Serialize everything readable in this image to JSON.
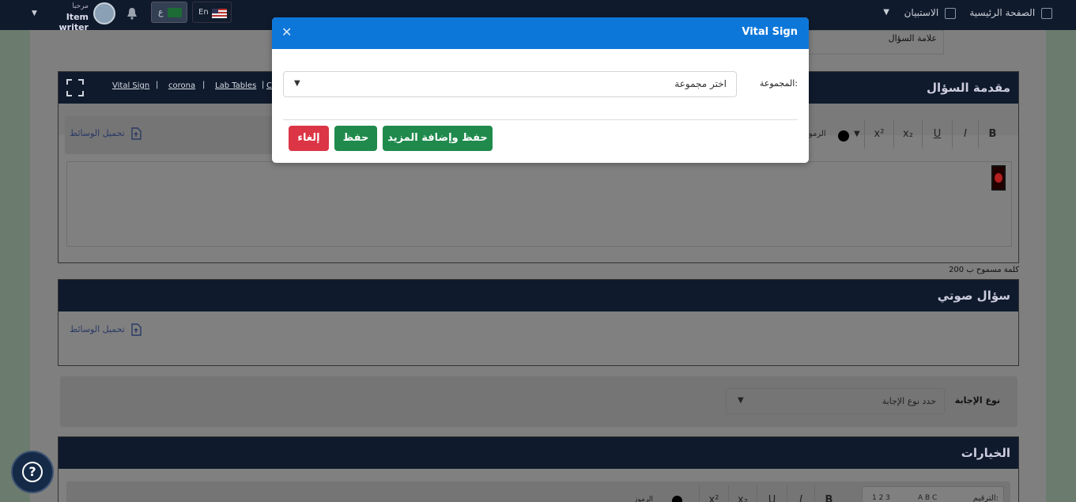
{
  "topbar": {
    "home": "الصفحة الرئيسية",
    "questionnaires": "الاستبيان",
    "greeting": "مرحبا",
    "user_name": "Item writer",
    "lang_ar": "ع",
    "lang_en": "En"
  },
  "question_mark": {
    "label": "علامة السؤال"
  },
  "intro_section": {
    "title": "مقدمة السؤال",
    "crumbs": [
      "Vital Sign",
      "corona",
      "Lab Tables",
      "C"
    ],
    "symbols_label": "الرموز",
    "upload_label": "تحميل الوسائط",
    "word_limit": "200 كلمة مسموح ب"
  },
  "toolbar": {
    "bold": "B",
    "italic": "I",
    "underline": "U",
    "sub": "x₂",
    "sup": "x²"
  },
  "audio_section": {
    "title": "سؤال صوتي",
    "upload_label": "تحميل الوسائط"
  },
  "answer_type": {
    "label": "نوع الإجابة",
    "placeholder": "حدد نوع الإجابة"
  },
  "options_section": {
    "title": "الخيارات",
    "numbering_label": "الترقيم:",
    "numbering_abc": "A B C",
    "numbering_123": "1 2 3",
    "symbols_label": "الرموز"
  },
  "modal": {
    "title": "Vital Sign",
    "field_label": "المجموعة:",
    "select_value": "اختر مجموعة",
    "btn_save_more": "حفظ وإضافة المزيد",
    "btn_save": "حفظ",
    "btn_cancel": "إلغاء"
  },
  "colors": {
    "modal_header": "#0d77d9",
    "save": "#1f8a4c",
    "cancel": "#dc3545",
    "dark_header": "#0f1a2c"
  }
}
